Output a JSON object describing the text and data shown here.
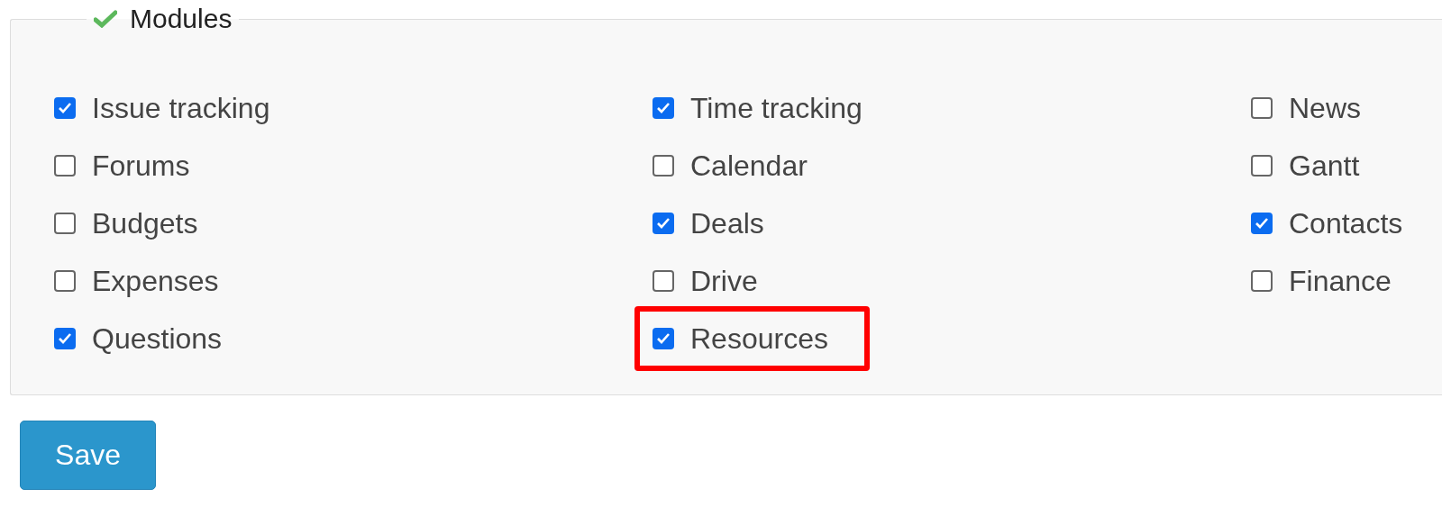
{
  "panel": {
    "legend": "Modules"
  },
  "modules": [
    {
      "label": "Issue tracking",
      "checked": true,
      "highlighted": false
    },
    {
      "label": "Time tracking",
      "checked": true,
      "highlighted": false
    },
    {
      "label": "News",
      "checked": false,
      "highlighted": false
    },
    {
      "label": "Forums",
      "checked": false,
      "highlighted": false
    },
    {
      "label": "Calendar",
      "checked": false,
      "highlighted": false
    },
    {
      "label": "Gantt",
      "checked": false,
      "highlighted": false
    },
    {
      "label": "Budgets",
      "checked": false,
      "highlighted": false
    },
    {
      "label": "Deals",
      "checked": true,
      "highlighted": false
    },
    {
      "label": "Contacts",
      "checked": true,
      "highlighted": false
    },
    {
      "label": "Expenses",
      "checked": false,
      "highlighted": false
    },
    {
      "label": "Drive",
      "checked": false,
      "highlighted": false
    },
    {
      "label": "Finance",
      "checked": false,
      "highlighted": false
    },
    {
      "label": "Questions",
      "checked": true,
      "highlighted": false
    },
    {
      "label": "Resources",
      "checked": true,
      "highlighted": true
    }
  ],
  "save_button": "Save"
}
